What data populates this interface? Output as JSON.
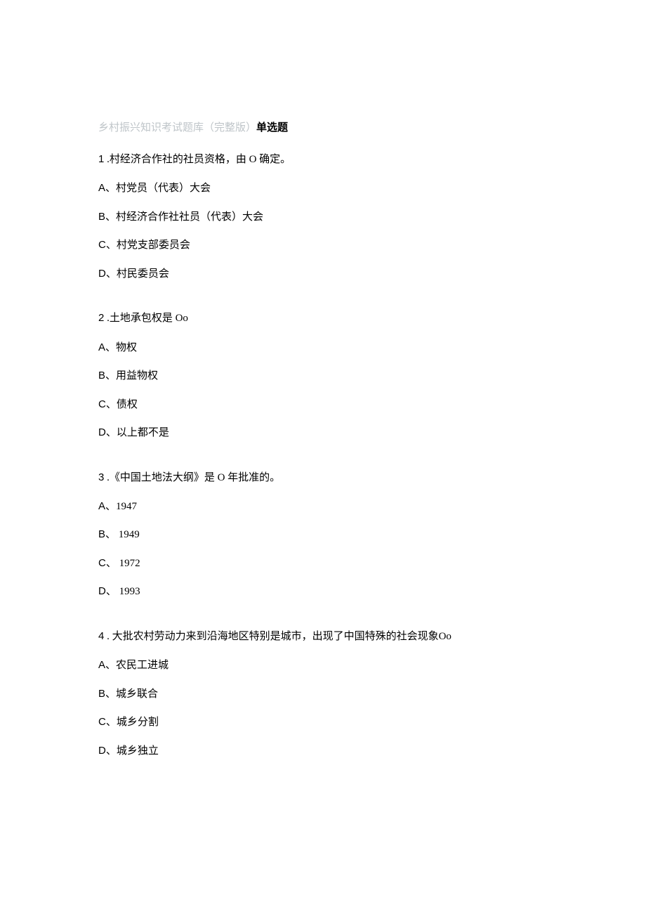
{
  "title": {
    "gray": "乡村振兴知识考试题库（完整版）",
    "bold": "单选题"
  },
  "questions": [
    {
      "num": "1",
      "stem": " .村经济合作社的社员资格，由 O 确定。",
      "options": [
        {
          "letter": "A",
          "text": "、村党员（代表）大会"
        },
        {
          "letter": "B",
          "text": "、村经济合作社社员（代表）大会"
        },
        {
          "letter": "C",
          "text": "、村党支部委员会"
        },
        {
          "letter": "D",
          "text": "、村民委员会"
        }
      ]
    },
    {
      "num": "2",
      "stem": " .土地承包权是 Oo",
      "options": [
        {
          "letter": "A",
          "text": "、物权"
        },
        {
          "letter": "B",
          "text": "、用益物权"
        },
        {
          "letter": "C",
          "text": "、债权"
        },
        {
          "letter": "D",
          "text": "、以上都不是"
        }
      ]
    },
    {
      "num": "3",
      "stem": " .《中国土地法大纲》是 O 年批准的。",
      "options": [
        {
          "letter": "A",
          "text": "、1947"
        },
        {
          "letter": "B",
          "text": "、 1949"
        },
        {
          "letter": "C",
          "text": "、 1972"
        },
        {
          "letter": "D",
          "text": "、 1993"
        }
      ]
    },
    {
      "num": "4",
      "stem": " . 大批农村劳动力来到沿海地区特别是城市，出现了中国特殊的社会现象Oo",
      "options": [
        {
          "letter": "A",
          "text": "、农民工进城"
        },
        {
          "letter": "B",
          "text": "、城乡联合"
        },
        {
          "letter": "C",
          "text": "、城乡分割"
        },
        {
          "letter": "D",
          "text": "、城乡独立"
        }
      ]
    }
  ]
}
